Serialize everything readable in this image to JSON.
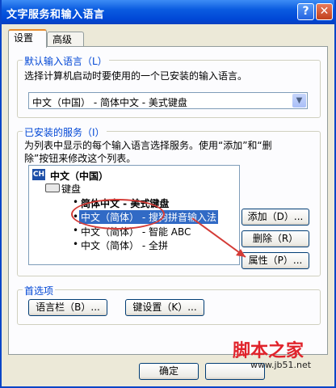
{
  "window": {
    "title": "文字服务和输入语言"
  },
  "titlebar": {
    "help_label": "?",
    "close_label": "✕"
  },
  "tabs": [
    {
      "label": "设置"
    },
    {
      "label": "高级"
    }
  ],
  "default_language": {
    "group_title": "默认输入语言（L）",
    "description": "选择计算机启动时要使用的一个已安装的输入语言。",
    "selected": "中文（中国） - 简体中文 - 美式键盘",
    "arrow": "▼"
  },
  "installed_services": {
    "group_title": "已安装的服务（I）",
    "description_line1": "为列表中显示的每个输入语言选择服务。使用“添加”和“删",
    "description_line2": "除”按钮来修改这个列表。",
    "language_badge": "CH",
    "language": "中文（中国）",
    "category": "键盘",
    "items": [
      {
        "label": "简体中文 - 美式键盘",
        "bullet": "•"
      },
      {
        "label": "中文（简体） - 搜狗拼音输入法",
        "bullet": "•"
      },
      {
        "label": "中文（简体） - 智能 ABC",
        "bullet": "•"
      },
      {
        "label": "中文（简体） - 全拼",
        "bullet": "•"
      }
    ],
    "add_button": "添加（D）...",
    "remove_button": "删除（R）",
    "properties_button": "属性（P）..."
  },
  "preferences": {
    "group_title": "首选项",
    "language_bar_button": "语言栏（B）...",
    "key_settings_button": "键设置（K）..."
  },
  "footer": {
    "ok_button": "确定",
    "cancel_button": ""
  },
  "watermark": {
    "brand": "脚本之家",
    "url": "www.jb51.net"
  },
  "colors": {
    "title_bar": "#0a5be0",
    "group_title": "#0046d5",
    "selection": "#316ac5",
    "annotation": "#d43b36",
    "watermark": "#e0232b"
  }
}
